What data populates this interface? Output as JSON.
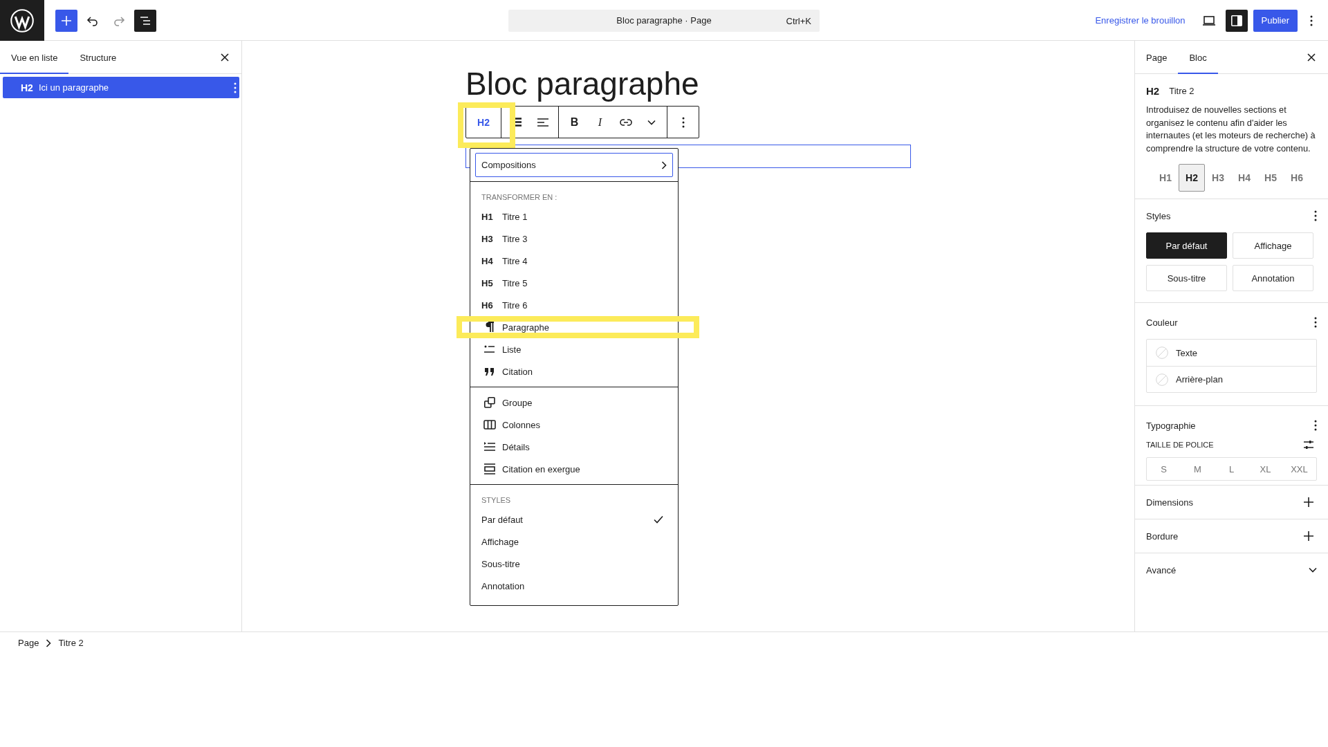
{
  "top_bar": {
    "list_view_on": true,
    "sidebar_on": true,
    "command_center": {
      "title": "Bloc paragraphe · Page",
      "shortcut": "Ctrl+K"
    },
    "save_draft": "Enregistrer le brouillon",
    "publish": "Publier"
  },
  "list_view": {
    "tabs": [
      {
        "label": "Vue en liste",
        "selected": true
      },
      {
        "label": "Structure",
        "selected": false
      }
    ],
    "items": [
      {
        "badge": "H2",
        "label": "Ici un paragraphe",
        "selected": true
      }
    ]
  },
  "editor": {
    "heading": "Bloc paragraphe",
    "toolbar": {
      "block_type": "H2",
      "highlighted": true,
      "bold": "B",
      "italic": "I"
    },
    "menu": {
      "compositions": "Compositions",
      "groups": [
        {
          "title": "TRANSFORMER EN :",
          "items": [
            {
              "kind": "heading",
              "badge": "H1",
              "label": "Titre 1",
              "highlighted": false
            },
            {
              "kind": "heading",
              "badge": "H3",
              "label": "Titre 3",
              "highlighted": false
            },
            {
              "kind": "heading",
              "badge": "H4",
              "label": "Titre 4",
              "highlighted": false
            },
            {
              "kind": "heading",
              "badge": "H5",
              "label": "Titre 5",
              "highlighted": false
            },
            {
              "kind": "heading",
              "badge": "H6",
              "label": "Titre 6",
              "highlighted": false
            },
            {
              "kind": "paragraph",
              "label": "Paragraphe",
              "highlighted": true
            },
            {
              "kind": "list",
              "label": "Liste",
              "highlighted": false
            },
            {
              "kind": "quote",
              "label": "Citation",
              "highlighted": false
            }
          ]
        },
        {
          "items": [
            {
              "kind": "group",
              "label": "Groupe"
            },
            {
              "kind": "columns",
              "label": "Colonnes"
            },
            {
              "kind": "details",
              "label": "Détails"
            },
            {
              "kind": "pullquote",
              "label": "Citation en exergue"
            }
          ]
        },
        {
          "title": "STYLES",
          "items": [
            {
              "kind": "style",
              "label": "Par défaut",
              "checked": true
            },
            {
              "kind": "style",
              "label": "Affichage",
              "checked": false
            },
            {
              "kind": "style",
              "label": "Sous-titre",
              "checked": false
            },
            {
              "kind": "style",
              "label": "Annotation",
              "checked": false
            }
          ]
        }
      ]
    }
  },
  "sidebar": {
    "tabs": [
      {
        "label": "Page",
        "selected": false
      },
      {
        "label": "Bloc",
        "selected": true
      }
    ],
    "block_card": {
      "badge": "H2",
      "title": "Titre 2",
      "description": "Introduisez de nouvelles sections et organisez le contenu afin d'aider les internautes (et les moteurs de recherche) à comprendre la structure de votre contenu."
    },
    "levels": [
      {
        "label": "H1",
        "selected": false
      },
      {
        "label": "H2",
        "selected": true
      },
      {
        "label": "H3",
        "selected": false
      },
      {
        "label": "H4",
        "selected": false
      },
      {
        "label": "H5",
        "selected": false
      },
      {
        "label": "H6",
        "selected": false
      }
    ],
    "panels": [
      {
        "kind": "styles",
        "title": "Styles",
        "options": [
          {
            "label": "Par défaut",
            "selected": true
          },
          {
            "label": "Affichage",
            "selected": false
          },
          {
            "label": "Sous-titre",
            "selected": false
          },
          {
            "label": "Annotation",
            "selected": false
          }
        ]
      },
      {
        "kind": "color",
        "title": "Couleur",
        "items": [
          "Texte",
          "Arrière-plan"
        ]
      },
      {
        "kind": "typography",
        "title": "Typographie",
        "font_size_label": "TAILLE DE POLICE",
        "sizes": [
          "S",
          "M",
          "L",
          "XL",
          "XXL"
        ]
      },
      {
        "kind": "add",
        "title": "Dimensions"
      },
      {
        "kind": "add",
        "title": "Bordure"
      },
      {
        "kind": "collapsed",
        "title": "Avancé"
      }
    ]
  },
  "breadcrumbs": [
    "Page",
    "Titre 2"
  ]
}
